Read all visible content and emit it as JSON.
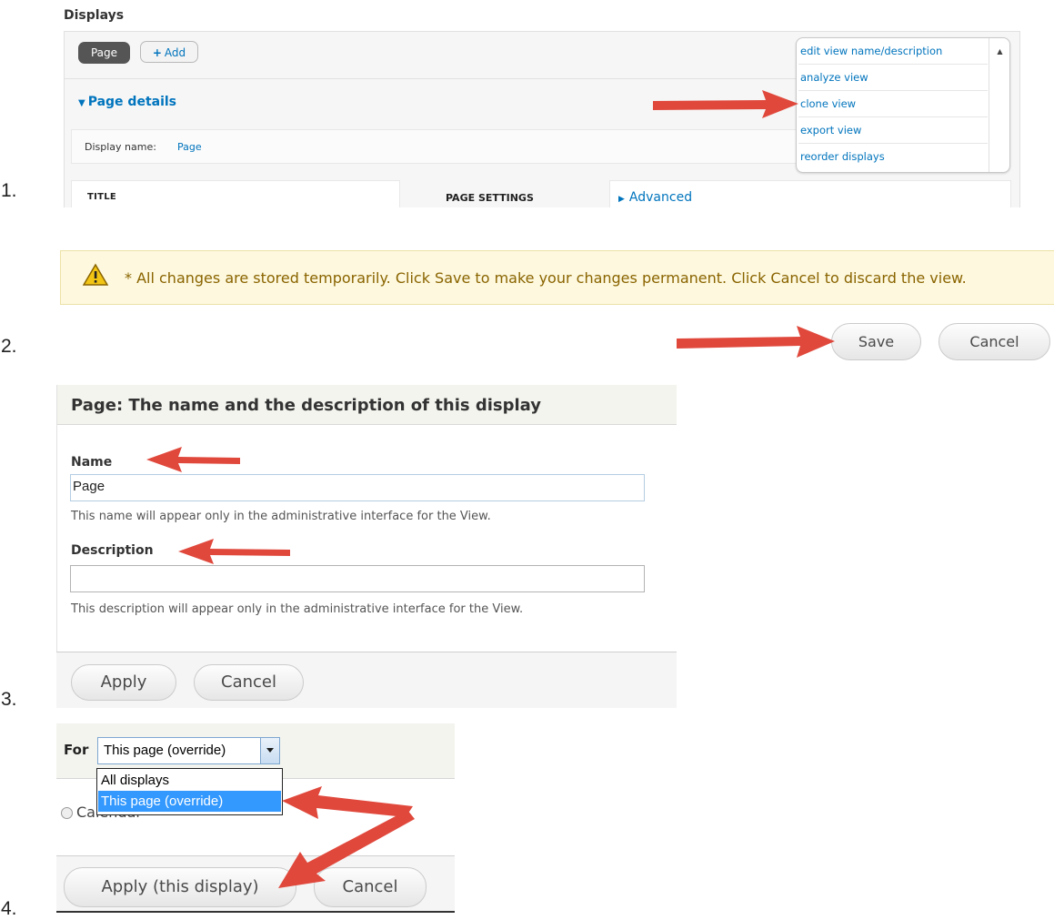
{
  "step_numbers": [
    "1.",
    "2.",
    "3.",
    "4."
  ],
  "step1": {
    "section_label": "Displays",
    "tab_page": "Page",
    "tab_add": "Add",
    "details_title": "Page details",
    "display_name_label": "Display name:",
    "display_name_value": "Page",
    "title_heading": "TITLE",
    "page_settings_heading": "PAGE SETTINGS",
    "advanced_link": "Advanced",
    "menu_items": [
      "edit view name/description",
      "analyze view",
      "clone view",
      "export view",
      "reorder displays"
    ]
  },
  "step2": {
    "warning_text": "* All changes are stored temporarily. Click Save to make your changes permanent. Click Cancel to discard the view.",
    "save_label": "Save",
    "cancel_label": "Cancel"
  },
  "step3": {
    "title": "Page: The name and the description of this display",
    "name_label": "Name",
    "name_value": "Page",
    "name_help": "This name will appear only in the administrative interface for the View.",
    "description_label": "Description",
    "description_value": "",
    "description_help": "This description will appear only in the administrative interface for the View.",
    "apply_label": "Apply",
    "cancel_label": "Cancel"
  },
  "step4": {
    "for_label": "For",
    "selected_value": "This page (override)",
    "options": [
      "All displays",
      "This page (override)"
    ],
    "radio_label": "Calendar",
    "apply_label": "Apply (this display)",
    "cancel_label": "Cancel"
  },
  "colors": {
    "link_blue": "#0074bd",
    "arrow_red": "#e0483c",
    "warning_bg": "#fdf8de",
    "selected_option_bg": "#3399ff"
  }
}
